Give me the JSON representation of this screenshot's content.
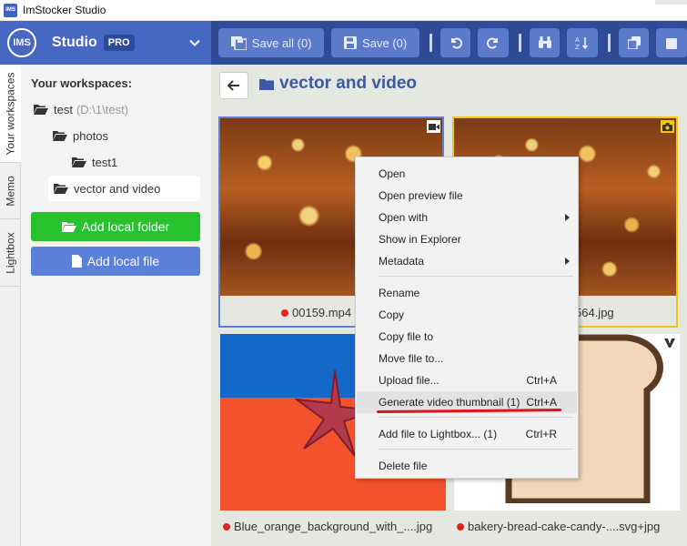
{
  "window": {
    "title": "ImStocker Studio",
    "icon_text": "IMS"
  },
  "topbar": {
    "logo_text": "IMS",
    "brand": "Studio",
    "badge": "PRO",
    "toolbar": {
      "save_all_label": "Save all (0)",
      "save_label": "Save (0)"
    }
  },
  "vtabs": [
    "Your workspaces",
    "Memo",
    "Lightbox"
  ],
  "sidebar": {
    "title": "Your workspaces:",
    "tree": [
      {
        "label": "test",
        "path": "(D:\\1\\test)"
      },
      {
        "label": "photos"
      },
      {
        "label": "test1"
      },
      {
        "label": "vector and video"
      }
    ],
    "add_folder_label": "Add local folder",
    "add_file_label": "Add local file"
  },
  "main": {
    "breadcrumb": "vector and video",
    "files": [
      {
        "name": "00159.mp4",
        "type": "video"
      },
      {
        "name": "564.jpg",
        "type": "photo"
      },
      {
        "name": "Blue_orange_background_with_....jpg",
        "type": "photo"
      },
      {
        "name": "bakery-bread-cake-candy-....svg+jpg",
        "type": "vector"
      }
    ]
  },
  "context_menu": {
    "items": [
      {
        "label": "Open"
      },
      {
        "label": "Open preview file"
      },
      {
        "label": "Open with"
      },
      {
        "label": "Show in Explorer"
      },
      {
        "label": "Metadata"
      },
      {
        "label": "Rename"
      },
      {
        "label": "Copy"
      },
      {
        "label": "Copy file to"
      },
      {
        "label": "Move file to..."
      },
      {
        "label": "Upload file...",
        "shortcut": "Ctrl+A"
      },
      {
        "label": "Generate video thumbnail (1)",
        "shortcut": "Ctrl+A"
      },
      {
        "label": "Add file to Lightbox... (1)",
        "shortcut": "Ctrl+R"
      },
      {
        "label": "Delete file"
      }
    ]
  },
  "colors": {
    "topbar": "#4668c2",
    "toolbar": "#2f4b97",
    "green_button": "#27c22e",
    "blue_button": "#5b80da",
    "selected_border_video": "#5b80da",
    "selected_border_photo": "#f0c419",
    "status_dot": "#e0251f"
  }
}
